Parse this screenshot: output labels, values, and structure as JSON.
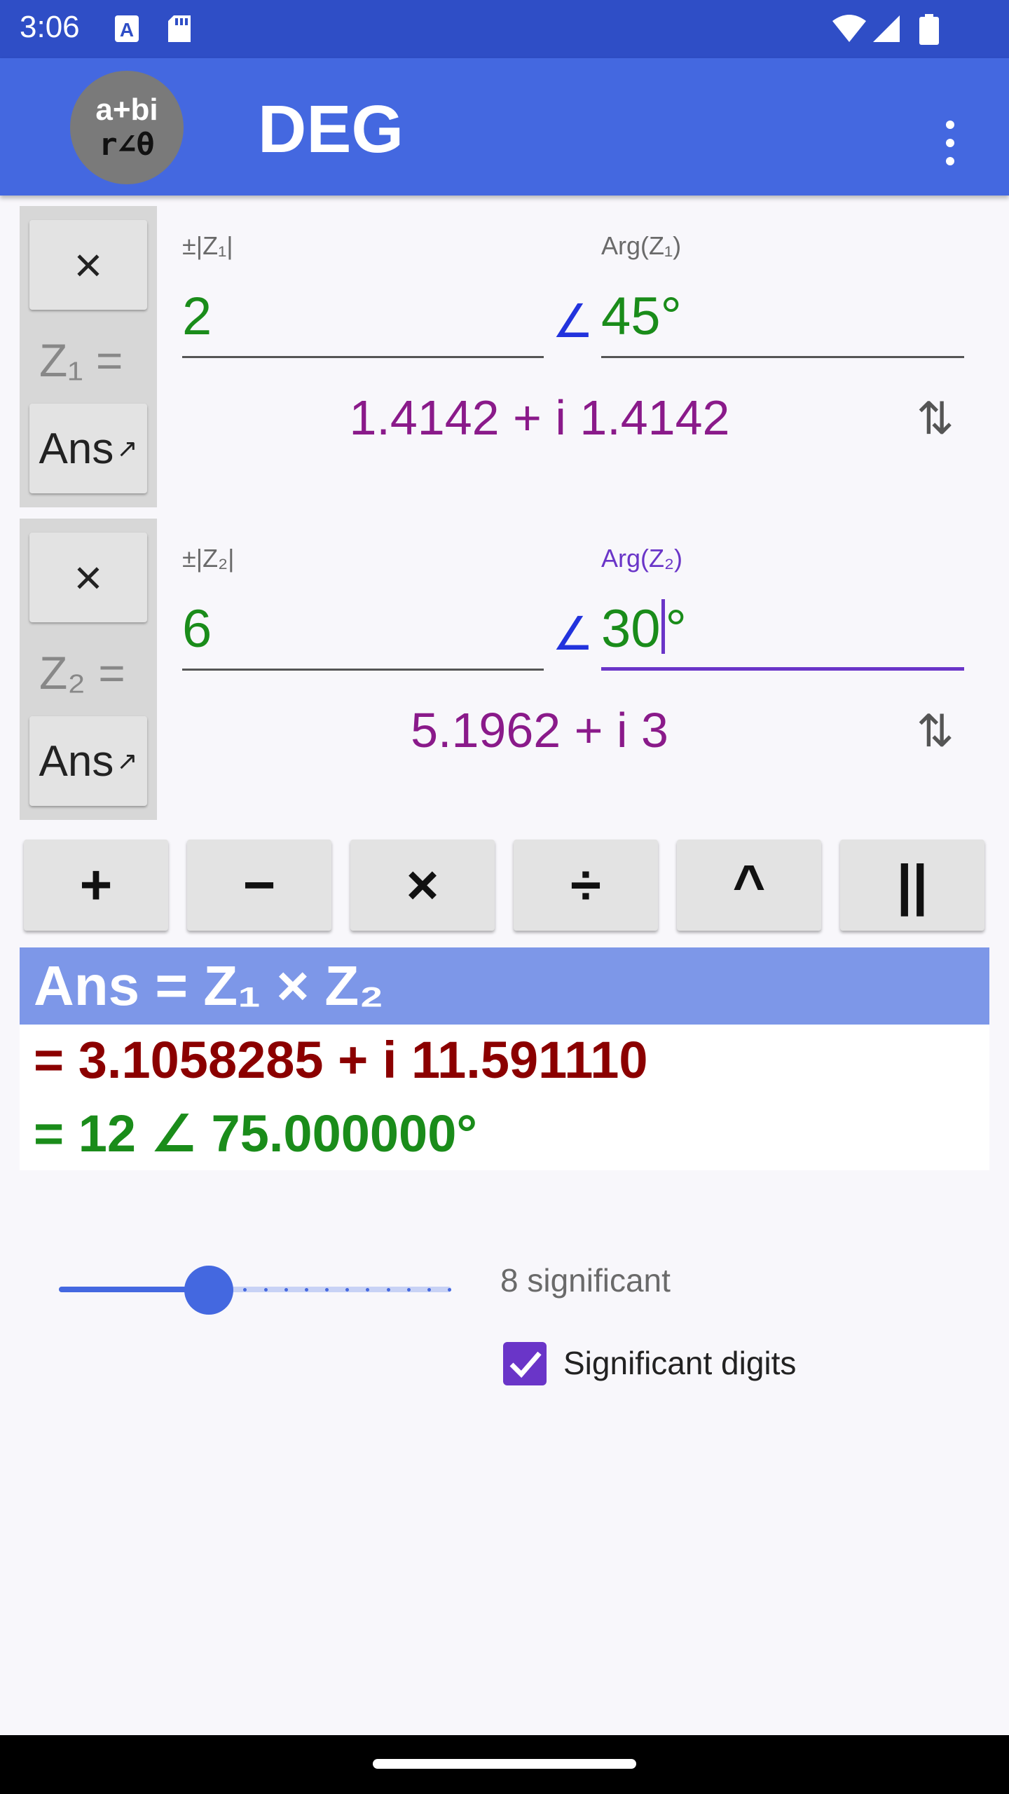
{
  "status_bar": {
    "time": "3:06",
    "icons": [
      "notification-a-icon",
      "sd-card-icon",
      "wifi-icon",
      "signal-icon",
      "battery-icon"
    ]
  },
  "app_bar": {
    "mode_badge": {
      "line1": "a+bi",
      "line2": "r∠θ"
    },
    "title": "DEG",
    "menu_icon": "more-vert-icon"
  },
  "z1": {
    "label": "Z₁ =",
    "mag_label": "±|Z₁|",
    "mag_value": "2",
    "angle_symbol": "∠",
    "arg_label": "Arg(Z₁)",
    "arg_value": "45°",
    "rect": "1.4142 + i 1.4142",
    "close_label": "×",
    "ans_label": "Ans",
    "ans_arrow": "↗",
    "swap_icon": "⇅"
  },
  "z2": {
    "label": "Z₂ =",
    "mag_label": "±|Z₂|",
    "mag_value": "6",
    "angle_symbol": "∠",
    "arg_label": "Arg(Z₂)",
    "arg_value": "30°",
    "arg_value_before_cursor": "30",
    "arg_value_after_cursor": "°",
    "rect": "5.1962 + i 3",
    "close_label": "×",
    "ans_label": "Ans",
    "ans_arrow": "↗",
    "swap_icon": "⇅"
  },
  "operators": [
    "+",
    "−",
    "×",
    "÷",
    "^",
    "||"
  ],
  "answer": {
    "header_text": "Ans = Z₁ × Z₂",
    "rect": "= 3.1058285 + i 11.591110",
    "polar": "= 12 ∠ 75.000000°"
  },
  "precision": {
    "slider_value": 8,
    "slider_min": 1,
    "slider_max": 20,
    "label": "8 significant",
    "checkbox_label": "Significant digits",
    "checkbox_checked": true
  },
  "colors": {
    "status_bar": "#2f4ec6",
    "app_bar": "#4468e0",
    "answer_header": "#7d97e8",
    "polar_value": "#1a8c1a",
    "rect_value": "#8a1a8a",
    "answer_rect": "#8b0000",
    "accent": "#6a35c8"
  }
}
